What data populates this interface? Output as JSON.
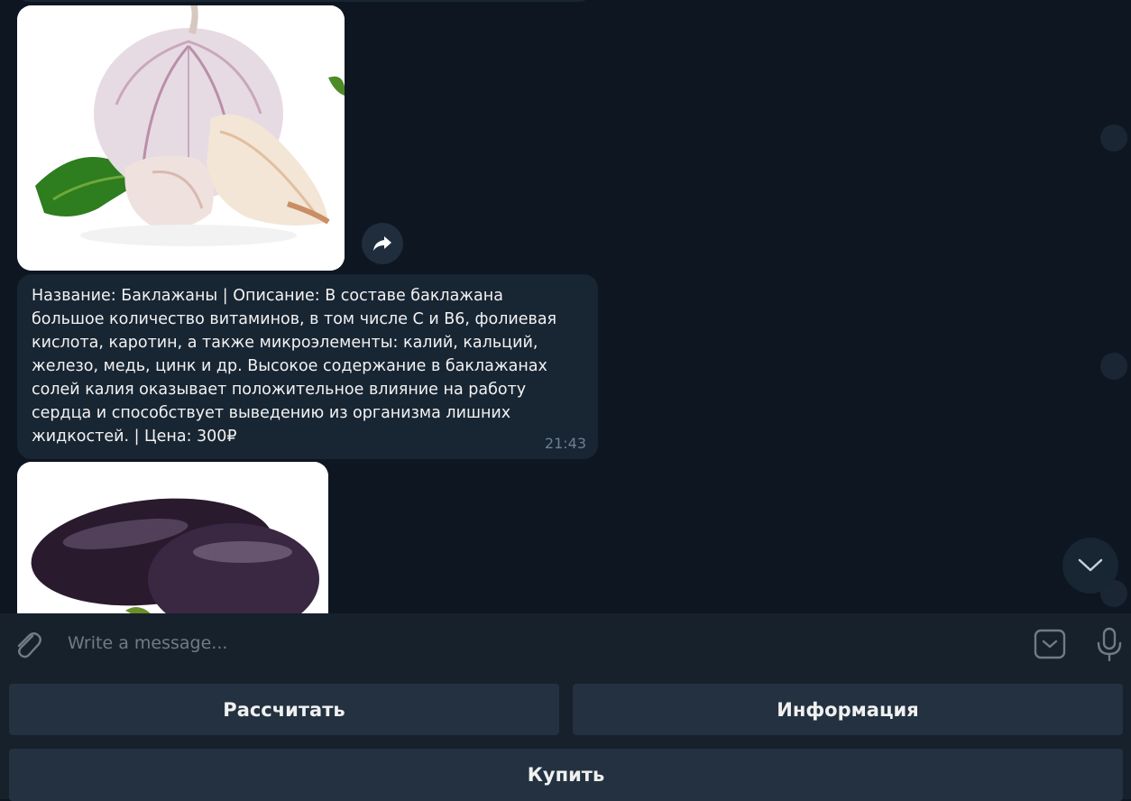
{
  "messages": [
    {
      "type": "photo",
      "image": "garlic-photo"
    },
    {
      "type": "text",
      "text": "Название: Баклажаны | Описание: В составе баклажана\nбольшое количество витаминов, в том числе С и В6, фолиевая\nкислота, каротин, а также микроэлементы: калий, кальций,\nжелезо, медь, цинк и др. Высокое содержание в баклажанах\nсолей калия оказывает положительное влияние на работу\nсердца и способствует выведению из организма лишних\nжидкостей. | Цена: 300₽",
      "time": "21:43"
    },
    {
      "type": "photo",
      "image": "eggplant-photo"
    }
  ],
  "composer": {
    "placeholder": "Write a message...",
    "attach_icon": "paperclip-icon",
    "keyboard_icon": "bot-keyboard-icon",
    "mic_icon": "microphone-icon"
  },
  "keyboard": {
    "buttons": [
      "Рассчитать",
      "Информация",
      "Купить"
    ]
  },
  "colors": {
    "background": "#0e1621",
    "bubble": "#182533",
    "panel": "#17212b",
    "key": "#233140"
  }
}
